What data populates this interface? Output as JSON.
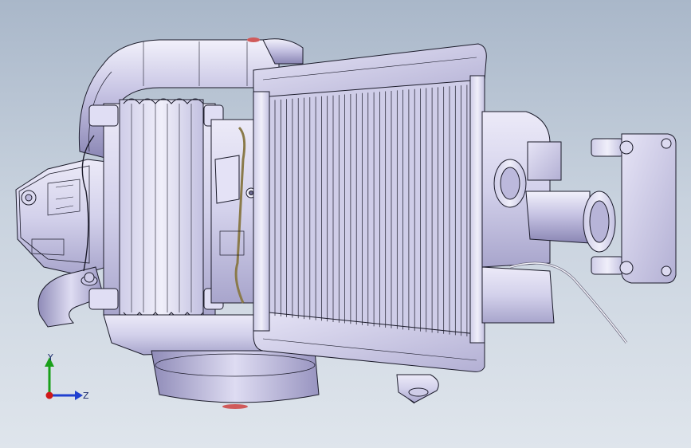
{
  "viewport": {
    "background_top": "#a9b7c9",
    "background_bottom": "#dfe5ec"
  },
  "triad": {
    "y_label": "Y",
    "z_label": "Z",
    "y_color": "#1aa01a",
    "z_color": "#2040d0",
    "x_color": "#d01818"
  },
  "model": {
    "body_color": "#d6d4ec",
    "shade_color": "#a9a6cc",
    "edge_color": "#1b1b2a",
    "accent_color": "#c9a36a"
  }
}
